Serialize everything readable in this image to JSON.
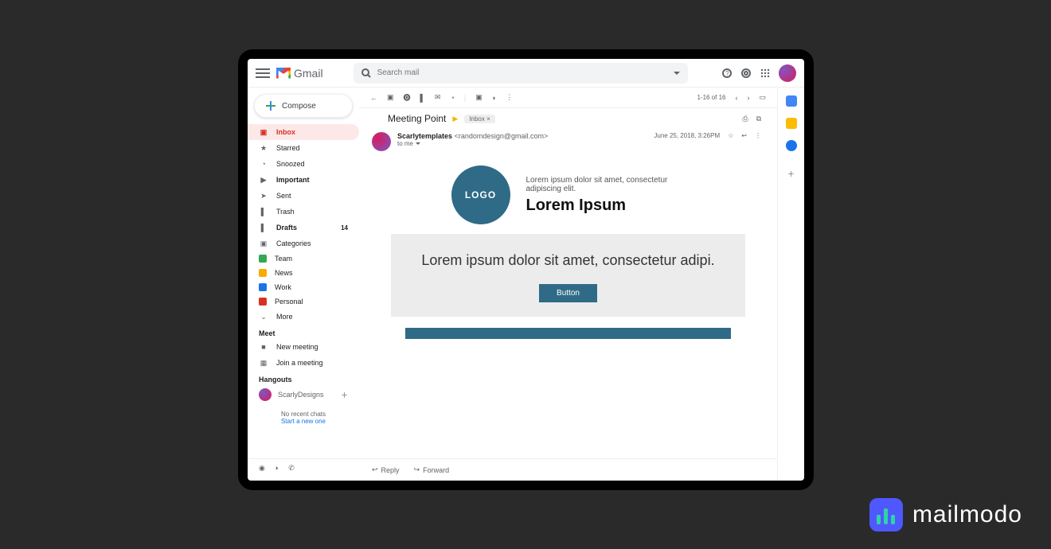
{
  "app": {
    "name": "Gmail"
  },
  "search": {
    "placeholder": "Search mail"
  },
  "compose": "Compose",
  "nav": [
    {
      "label": "Inbox",
      "active": true,
      "bold": true
    },
    {
      "label": "Starred"
    },
    {
      "label": "Snoozed"
    },
    {
      "label": "Important",
      "bold": true
    },
    {
      "label": "Sent"
    },
    {
      "label": "Trash"
    },
    {
      "label": "Drafts",
      "bold": true,
      "count": "14"
    },
    {
      "label": "Categories"
    },
    {
      "label": "Team",
      "color": "#34a853"
    },
    {
      "label": "News",
      "color": "#f9ab00"
    },
    {
      "label": "Work",
      "color": "#1a73e8"
    },
    {
      "label": "Personal",
      "color": "#d93025"
    },
    {
      "label": "More"
    }
  ],
  "meet": {
    "heading": "Meet",
    "items": [
      "New meeting",
      "Join a meeting"
    ]
  },
  "hangouts": {
    "heading": "Hangouts",
    "user": "ScarlyDesigns",
    "empty": "No recent chats",
    "start": "Start a new one"
  },
  "toolbar": {
    "pagination": "1-16 of 16"
  },
  "message": {
    "subject": "Meeting Point",
    "chip": "Inbox ×",
    "sender": "Scarlytemplates",
    "email": "<randomdesign@gmail.com>",
    "to": "to me",
    "date": "June 25, 2018, 3:26PM"
  },
  "body": {
    "logo": "LOGO",
    "tag": "Lorem ipsum dolor sit amet, consectetur adipiscing elit.",
    "title": "Lorem Ipsum",
    "block": "Lorem ipsum dolor sit amet, consectetur adipi.",
    "button": "Button"
  },
  "actions": {
    "reply": "Reply",
    "forward": "Forward"
  },
  "brand": "mailmodo"
}
